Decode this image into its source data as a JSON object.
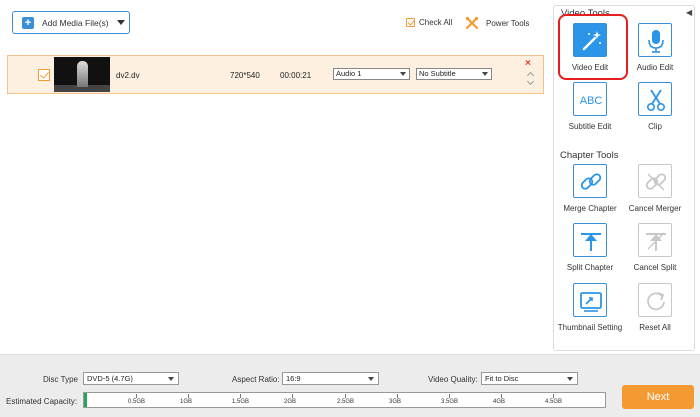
{
  "toolbar": {
    "add_media_label": "Add Media File(s)",
    "check_all_label": "Check All",
    "power_tools_label": "Power Tools"
  },
  "file": {
    "name": "dv2.dv",
    "resolution": "720*540",
    "duration": "00:00:21",
    "audio_track": "Audio 1",
    "subtitle": "No Subtitle"
  },
  "panel": {
    "video_tools_title": "Video Tools",
    "video_tools": [
      {
        "label": "Video Edit",
        "icon": "magic-wand-icon",
        "active": true
      },
      {
        "label": "Audio Edit",
        "icon": "microphone-icon"
      },
      {
        "label": "Subtitle Edit",
        "icon": "abc-text-icon"
      },
      {
        "label": "Clip",
        "icon": "scissors-icon"
      }
    ],
    "chapter_tools_title": "Chapter Tools",
    "chapter_tools": [
      {
        "label": "Merge Chapter",
        "icon": "link-icon"
      },
      {
        "label": "Cancel Merger",
        "icon": "unlink-icon",
        "disabled": true
      },
      {
        "label": "Split Chapter",
        "icon": "split-icon"
      },
      {
        "label": "Cancel Split",
        "icon": "cancel-split-icon",
        "disabled": true
      },
      {
        "label": "Thumbnail Setting",
        "icon": "thumbnail-icon"
      },
      {
        "label": "Reset All",
        "icon": "reset-icon",
        "disabled": true
      }
    ]
  },
  "bottom": {
    "disc_type_label": "Disc Type",
    "disc_type_value": "DVD-5 (4.7G)",
    "aspect_ratio_label": "Aspect Ratio:",
    "aspect_ratio_value": "16:9",
    "video_quality_label": "Video Quality:",
    "video_quality_value": "Fit to Disc",
    "capacity_label": "Estimated Capacity:",
    "capacity_fraction": 0.005,
    "capacity_ticks": [
      "0.5GB",
      "1GB",
      "1.5GB",
      "2GB",
      "2.5GB",
      "3GB",
      "3.5GB",
      "4GB",
      "4.5GB"
    ],
    "next_label": "Next"
  },
  "colors": {
    "accent_blue": "#2b95e8",
    "accent_orange": "#f39a32",
    "highlight_red": "#e61e1e",
    "capacity_green": "#23a55a"
  }
}
